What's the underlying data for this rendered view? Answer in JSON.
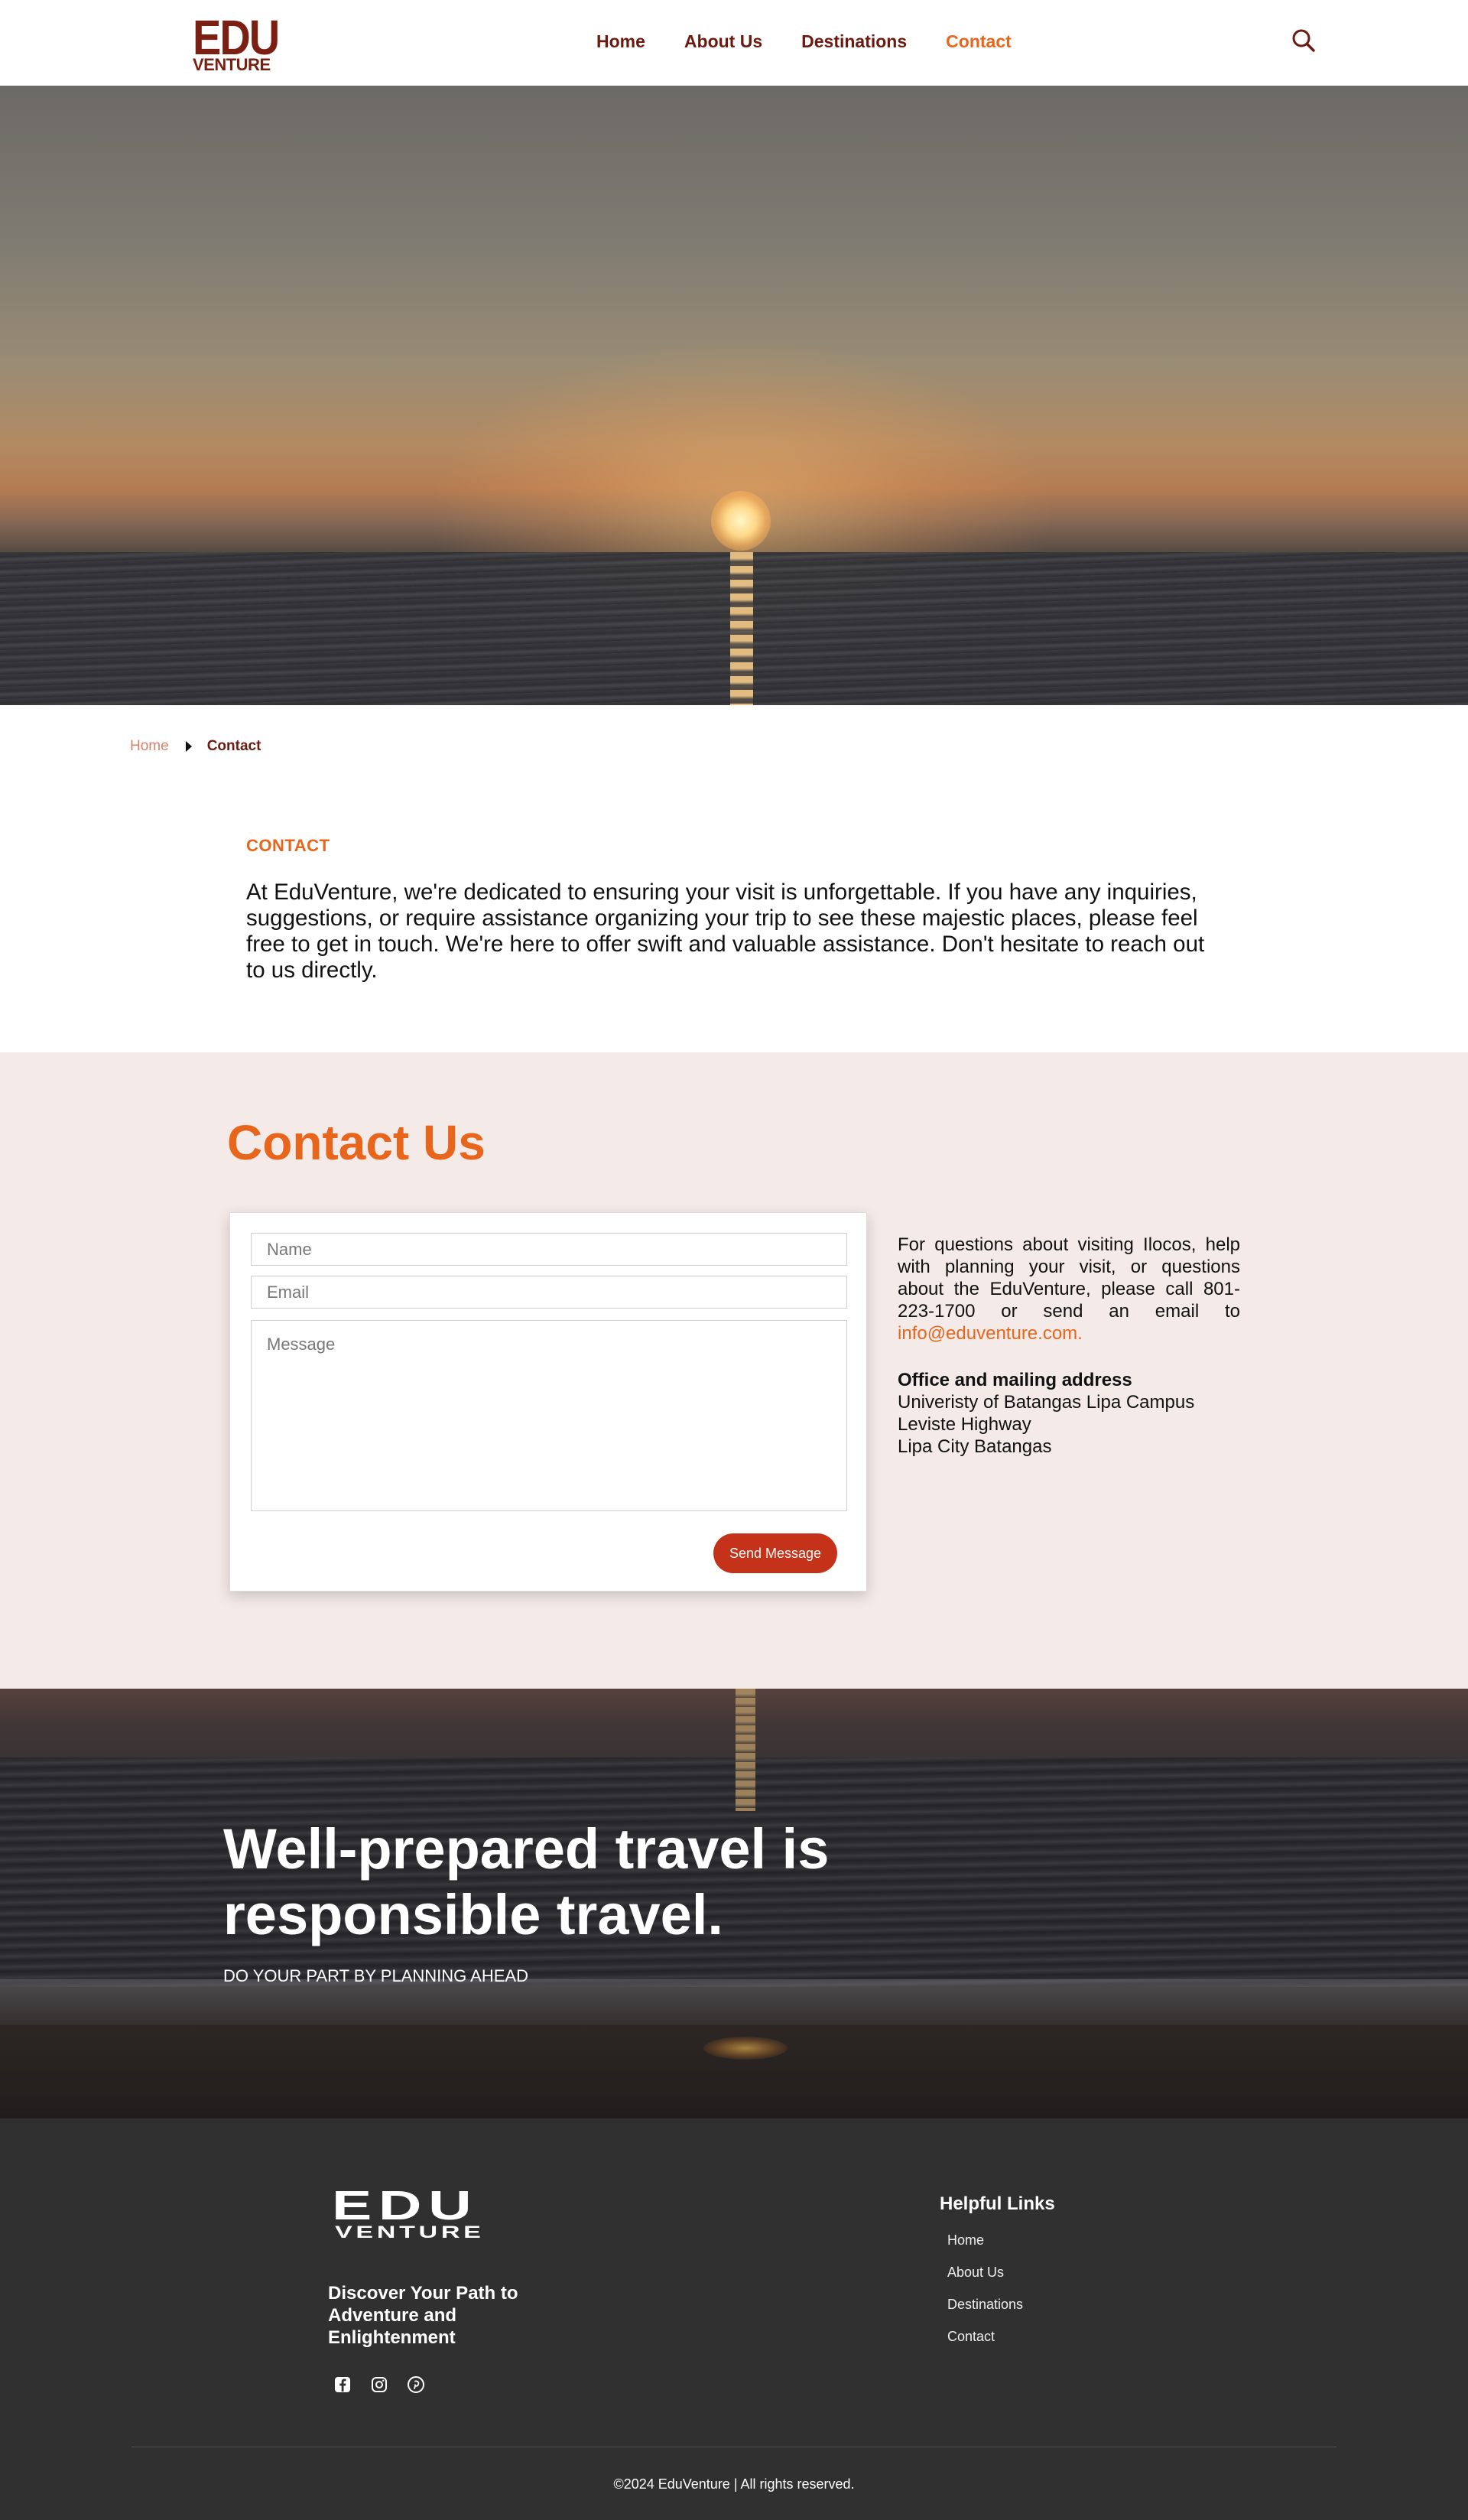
{
  "nav": {
    "logo_top": "EDU",
    "logo_bottom": "VENTURE",
    "items": [
      {
        "label": "Home",
        "active": false
      },
      {
        "label": "About Us",
        "active": false
      },
      {
        "label": "Destinations",
        "active": false
      },
      {
        "label": "Contact",
        "active": true
      }
    ],
    "search_icon": "search-icon"
  },
  "breadcrumb": {
    "home": "Home",
    "current": "Contact",
    "separator_icon": "caret-right-icon"
  },
  "intro": {
    "label": "CONTACT",
    "text": "At EduVenture, we're dedicated to ensuring your visit is unforgettable. If you have any inquiries, suggestions, or require assistance organizing your trip to see these majestic places, please feel free to get in touch. We're here to offer swift and valuable assistance. Don't hesitate to reach out to us directly."
  },
  "contact": {
    "title": "Contact Us",
    "form": {
      "name_placeholder": "Name",
      "email_placeholder": "Email",
      "message_placeholder": "Message",
      "send_label": "Send Message"
    },
    "info_text": "For questions about visiting Ilocos, help with planning your visit, or questions about the EduVenture, please call 801-223-1700 or send an email to ",
    "email": "info@eduventure.com.",
    "office_title": "Office and mailing address",
    "office_lines": [
      "Univeristy of Batangas Lipa Campus",
      "Leviste Highway",
      "Lipa City Batangas"
    ]
  },
  "banner": {
    "title": "Well-prepared travel is responsible travel.",
    "subtitle": "DO YOUR PART BY PLANNING AHEAD"
  },
  "footer": {
    "logo_top": "EDU",
    "logo_bottom": "VENTURE",
    "tagline": "Discover Your Path to Adventure and Enlightenment",
    "social_icons": [
      "facebook-icon",
      "instagram-icon",
      "pinterest-icon"
    ],
    "links_title": "Helpful Links",
    "links": [
      "Home",
      "About Us",
      "Destinations",
      "Contact"
    ],
    "copyright": "©2024 EduVenture | All rights reserved."
  },
  "colors": {
    "brand_dark": "#6b1a0f",
    "accent": "#e8651c",
    "button": "#c4321a",
    "section_bg": "#f4eae8",
    "footer_bg": "#303030"
  }
}
